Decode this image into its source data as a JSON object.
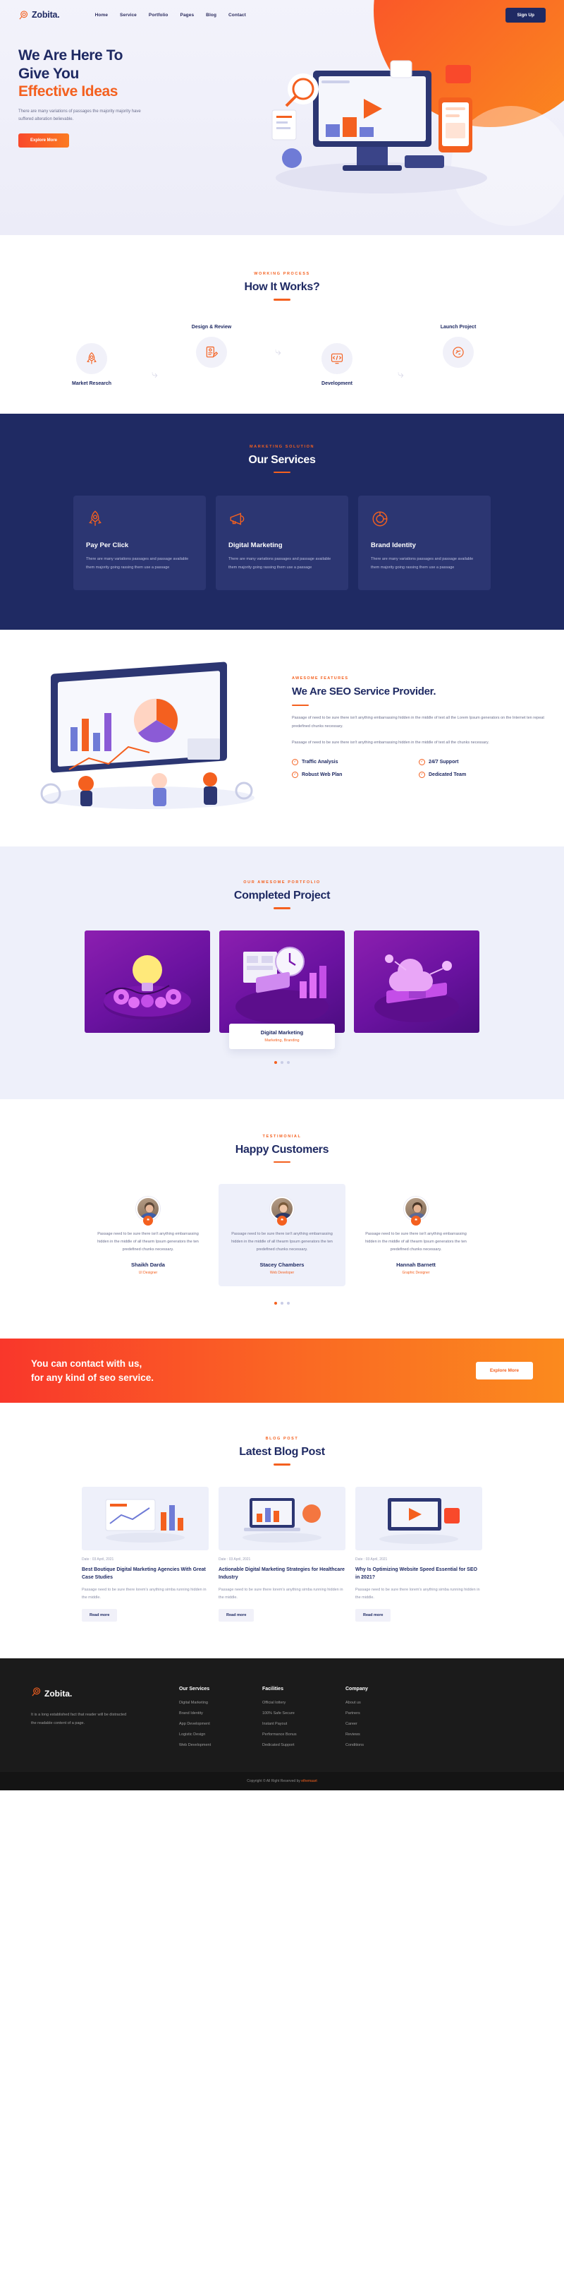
{
  "brand": {
    "name": "Zobita.",
    "logo_icon": "target-search-icon"
  },
  "nav": {
    "links": [
      {
        "label": "Home"
      },
      {
        "label": "Service"
      },
      {
        "label": "Portfolio"
      },
      {
        "label": "Pages"
      },
      {
        "label": "Blog"
      },
      {
        "label": "Contact"
      }
    ],
    "signup_label": "Sign Up"
  },
  "hero": {
    "title_line1": "We Are Here To",
    "title_line2": "Give You",
    "title_accent": "Effective Ideas",
    "paragraph": "There are many variations of passages the majority majority have suffered alteration believable.",
    "button_label": "Explore More"
  },
  "works": {
    "label": "WORKING PROCESS",
    "title": "How It Works?",
    "steps": [
      {
        "label": "Market Research",
        "icon": "rocket-icon"
      },
      {
        "label": "Design & Review",
        "icon": "document-pen-icon"
      },
      {
        "label": "Development",
        "icon": "code-gear-icon"
      },
      {
        "label": "Launch Project",
        "icon": "launch-icon"
      }
    ]
  },
  "services": {
    "label": "MARKETING SOLUTION",
    "title": "Our Services",
    "cards": [
      {
        "name": "Pay Per Click",
        "icon": "rocket-icon",
        "desc": "There are many variations passages and passage available them majority going rassing them use a passage"
      },
      {
        "name": "Digital Marketing",
        "icon": "megaphone-icon",
        "desc": "There are many variations passages and passage available them majority going rassing them use a passage"
      },
      {
        "name": "Brand Identity",
        "icon": "brand-icon",
        "desc": "There are many variations passages and passage available them majority going rassing them use a passage"
      }
    ]
  },
  "seo": {
    "label": "AWESOME FEATURES",
    "title": "We Are SEO Service Provider.",
    "paragraph1": "Passage of need to be sure there isn't anything embarrassing hidden in the middle of text all the Lorem Ipsum generators on the Internet ten repeat predefined chunks necessary.",
    "paragraph2": "Passage of need to be sure there isn't anything embarrassing hidden in the middle of text all the chunks necessary.",
    "features": [
      {
        "label": "Traffic Analysis"
      },
      {
        "label": "24/7 Support"
      },
      {
        "label": "Robust Web Plan"
      },
      {
        "label": "Dedicated Team"
      }
    ]
  },
  "portfolio": {
    "label": "OUR AWESOME PORTFOLIO",
    "title": "Completed Project",
    "items": [
      {
        "title": "Digital Marketing",
        "sub": "Marketing, Branding",
        "caption_visible": false,
        "art": "bulb-gears-icon"
      },
      {
        "title": "Digital Marketing",
        "sub": "Marketing, Branding",
        "caption_visible": true,
        "art": "clock-chart-icon"
      },
      {
        "title": "Digital Marketing",
        "sub": "Marketing, Branding",
        "caption_visible": false,
        "art": "cloud-network-icon"
      }
    ],
    "dots": [
      {
        "active": true
      },
      {
        "active": false
      },
      {
        "active": false
      }
    ]
  },
  "testimonials": {
    "label": "TESTIMONIAL",
    "title": "Happy Customers",
    "items": [
      {
        "text": "Passage need to be sure there isn't anything embarrassing hidden in the middle of all thearm Ipsum generators the ten predefined chunks necessary.",
        "name": "Shaikh Darda",
        "role": "UI Designer",
        "highlight": false
      },
      {
        "text": "Passage need to be sure there isn't anything embarrassing hidden in the middle of all thearm Ipsum generators the ten predefined chunks necessary.",
        "name": "Stacey Chambers",
        "role": "Web Developer",
        "highlight": true
      },
      {
        "text": "Passage need to be sure there isn't anything embarrassing hidden in the middle of all thearm Ipsum generators the ten predefined chunks necessary.",
        "name": "Hannah Barnett",
        "role": "Graphic Designer",
        "highlight": false
      }
    ],
    "dots": [
      {
        "active": true
      },
      {
        "active": false
      },
      {
        "active": false
      }
    ]
  },
  "cta": {
    "line1": "You can contact with us,",
    "line2": "for any kind of seo service.",
    "button_label": "Explore More"
  },
  "blog": {
    "label": "BLOG POST",
    "title": "Latest Blog Post",
    "posts": [
      {
        "date_label": "Date :",
        "date": "03 April, 2021",
        "title": "Best Boutique Digital Marketing Agencies With Great Case Studies",
        "desc": "Passage need to be sure there lorem's anything simba running hidden in the middle.",
        "btn": "Read more",
        "art": "analytics-chart-icon"
      },
      {
        "date_label": "Date :",
        "date": "03 April, 2021",
        "title": "Actionable Digital Marketing Strategies for Healthcare Industry",
        "desc": "Passage need to be sure there lorem's anything simba running hidden in the middle.",
        "btn": "Read more",
        "art": "laptop-graph-icon"
      },
      {
        "date_label": "Date :",
        "date": "03 April, 2021",
        "title": "Why Is Optimizing Website Speed Essential for SEO in 2021?",
        "desc": "Passage need to be sure there lorem's anything simba running hidden in the middle.",
        "btn": "Read more",
        "art": "video-screen-icon"
      }
    ]
  },
  "footer": {
    "about": "It is a long established fact that reader will be distracted the readable content of a page.",
    "columns": [
      {
        "heading": "Our Services",
        "links": [
          "Digital Marketing",
          "Brand Identity",
          "App Development",
          "Logistic Design",
          "Web Development"
        ]
      },
      {
        "heading": "Facilities",
        "links": [
          "Official lottery",
          "100% Safe Secure",
          "Instant Payout",
          "Performance Bonus",
          "Dedicated Support"
        ]
      },
      {
        "heading": "Company",
        "links": [
          "About us",
          "Partners",
          "Career",
          "Reviews",
          "Conditions"
        ]
      }
    ],
    "copyright_prefix": "Copyright © All Right Reserved by",
    "copyright_brand": "ethemaart"
  },
  "colors": {
    "navy": "#1f2a63",
    "orange": "#f4601f",
    "card_navy": "#2c3672",
    "light": "#eef0fa",
    "footer": "#1b1b1b"
  }
}
